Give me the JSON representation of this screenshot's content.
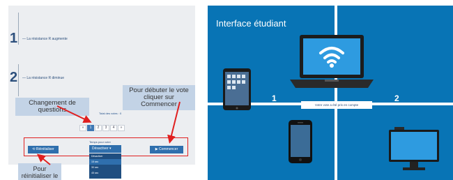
{
  "left": {
    "questions": [
      {
        "number": "1",
        "text": "La résistance R augmente"
      },
      {
        "number": "2",
        "text": "La résistance R diminue"
      }
    ],
    "total_votes": "Total des votes : 0",
    "pagination": [
      "«",
      "1",
      "2",
      "3",
      "4",
      "»"
    ],
    "active_page": "1",
    "buttons": {
      "reset": "Réinitialiser",
      "start": "Commencer"
    },
    "vote_time_label": "Temps pour voter",
    "select_value": "Désactiver",
    "dropdown_options": [
      "Désactiver",
      "15 sec",
      "30 sec",
      "45 sec"
    ],
    "dropdown_selected": "15 sec",
    "callouts": {
      "change_questions": "Changement de questions",
      "start_vote": "Pour débuter le vote cliquer sur Commencer",
      "reset_vote": "Pour réinitialiser le vote"
    },
    "arrow_color": "#e02020"
  },
  "right": {
    "title": "Interface étudiant",
    "zone_numbers": [
      "1",
      "2"
    ],
    "account_message": "Votre vote a été pris en compte",
    "background_color": "#0874b5",
    "devices": [
      "tablet-icon",
      "laptop-icon",
      "wifi-icon",
      "phone-icon",
      "monitor-icon"
    ]
  }
}
